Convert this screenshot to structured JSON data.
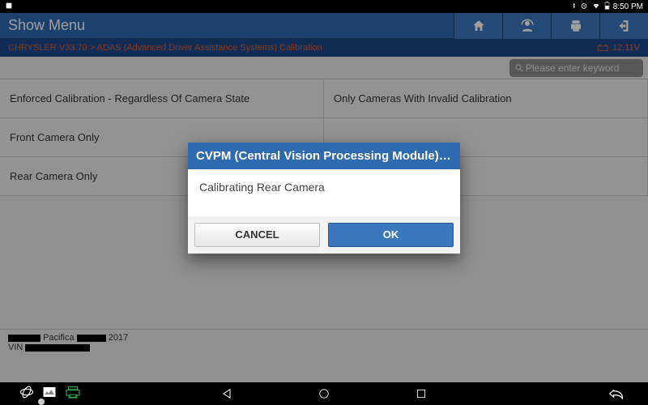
{
  "statusbar": {
    "time": "8:50 PM"
  },
  "appbar": {
    "title": "Show Menu"
  },
  "breadcrumb": {
    "path": "CHRYSLER V33.70 > ADAS (Advanced Driver Assistance Systems) Calibration",
    "voltage": "12.11V"
  },
  "search": {
    "placeholder": "Please enter keyword"
  },
  "options": [
    "Enforced Calibration - Regardless Of Camera State",
    "Only Cameras With Invalid Calibration",
    "Front Camera Only",
    "",
    "Rear Camera Only",
    ""
  ],
  "vehicle": {
    "model": "Pacifica",
    "year": "2017",
    "vin_label": "VIN"
  },
  "dialog": {
    "title": "CVPM (Central Vision Processing Module) S…",
    "message": "Calibrating Rear Camera",
    "cancel": "CANCEL",
    "ok": "OK"
  }
}
